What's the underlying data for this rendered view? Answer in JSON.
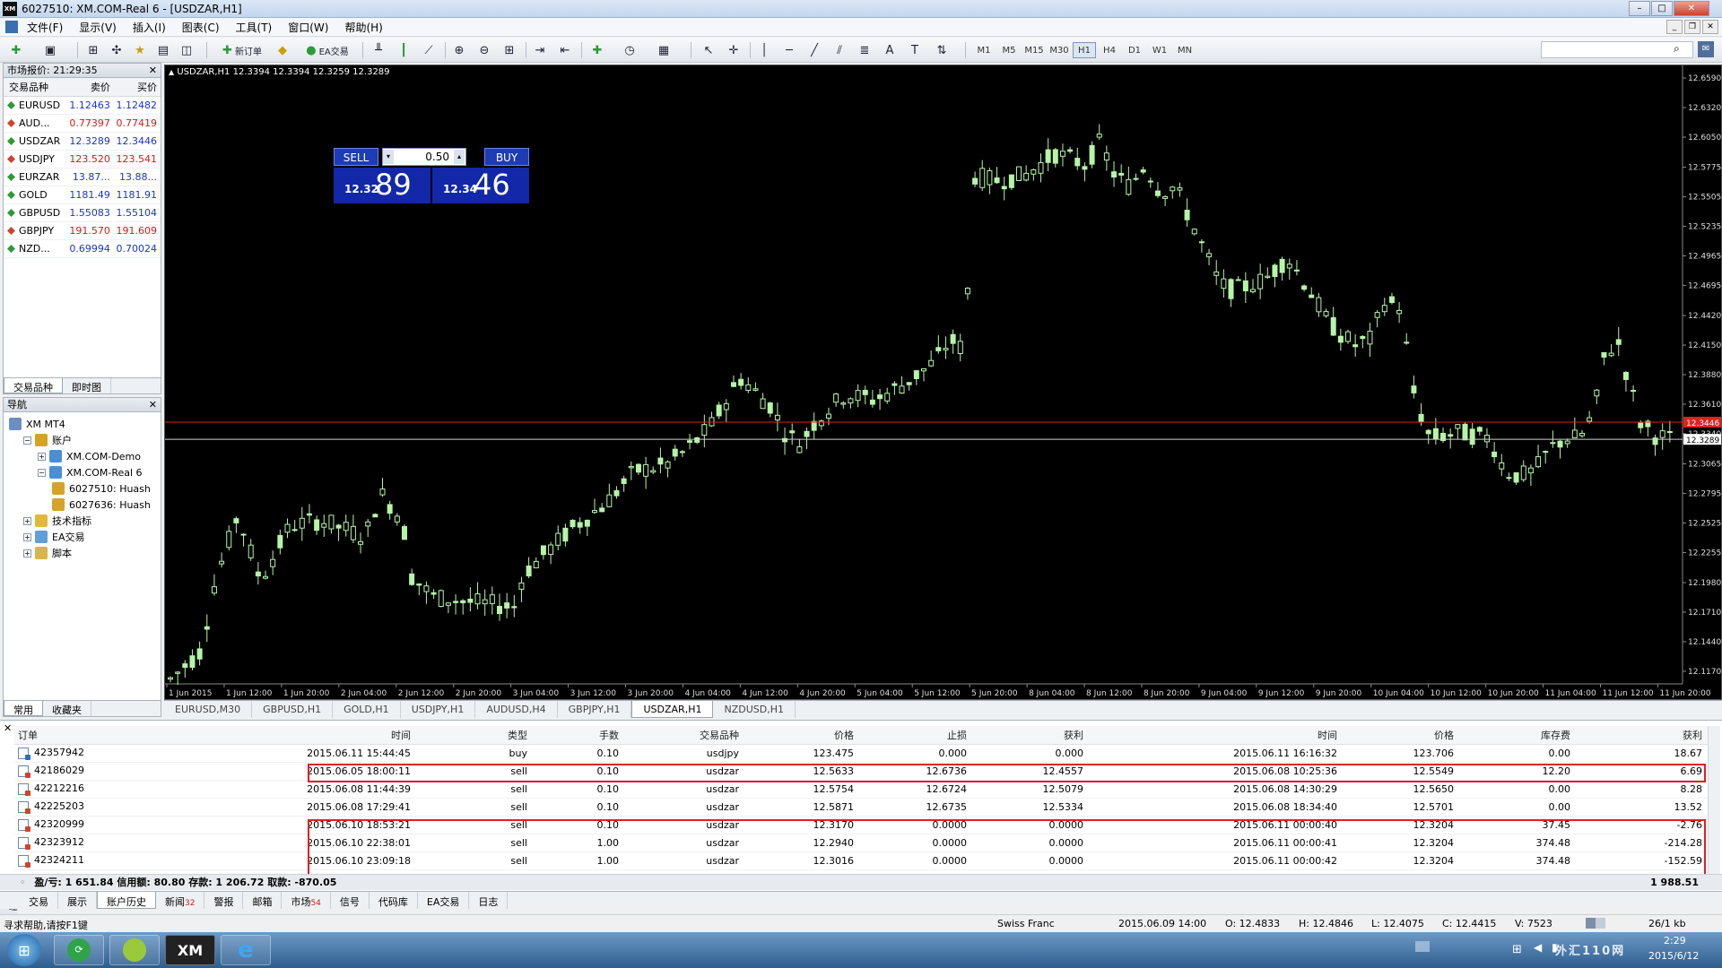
{
  "window": {
    "title": "6027510: XM.COM-Real 6 - [USDZAR,H1]",
    "app_icon": "XM"
  },
  "menu": [
    "文件(F)",
    "显示(V)",
    "插入(I)",
    "图表(C)",
    "工具(T)",
    "窗口(W)",
    "帮助(H)"
  ],
  "toolbar": {
    "new_order": "新订单",
    "ea_trading": "EA交易",
    "timeframes": [
      "M1",
      "M5",
      "M15",
      "M30",
      "H1",
      "H4",
      "D1",
      "W1",
      "MN"
    ],
    "active_timeframe": "H1"
  },
  "market_watch": {
    "title": "市场报价: 21:29:35",
    "headers": [
      "交易品种",
      "卖价",
      "买价"
    ],
    "rows": [
      {
        "symbol": "EURUSD",
        "bid": "1.12463",
        "ask": "1.12482",
        "dir": "up"
      },
      {
        "symbol": "AUD...",
        "bid": "0.77397",
        "ask": "0.77419",
        "dir": "down"
      },
      {
        "symbol": "USDZAR",
        "bid": "12.3289",
        "ask": "12.3446",
        "dir": "up"
      },
      {
        "symbol": "USDJPY",
        "bid": "123.520",
        "ask": "123.541",
        "dir": "down"
      },
      {
        "symbol": "EURZAR",
        "bid": "13.87...",
        "ask": "13.88...",
        "dir": "up"
      },
      {
        "symbol": "GOLD",
        "bid": "1181.49",
        "ask": "1181.91",
        "dir": "up"
      },
      {
        "symbol": "GBPUSD",
        "bid": "1.55083",
        "ask": "1.55104",
        "dir": "up"
      },
      {
        "symbol": "GBPJPY",
        "bid": "191.570",
        "ask": "191.609",
        "dir": "down"
      },
      {
        "symbol": "NZD...",
        "bid": "0.69994",
        "ask": "0.70024",
        "dir": "up"
      }
    ],
    "tabs": [
      "交易品种",
      "即时图"
    ]
  },
  "navigator": {
    "title": "导航",
    "items": [
      {
        "label": "XM MT4",
        "level": 0,
        "icon": "terminal-icon"
      },
      {
        "label": "账户",
        "level": 1,
        "icon": "accounts-icon"
      },
      {
        "label": "XM.COM-Demo",
        "level": 2,
        "icon": "server-icon"
      },
      {
        "label": "XM.COM-Real 6",
        "level": 2,
        "icon": "server-icon"
      },
      {
        "label": "6027510: Huash",
        "level": 3,
        "icon": "account-icon"
      },
      {
        "label": "6027636: Huash",
        "level": 3,
        "icon": "account-icon"
      },
      {
        "label": "技术指标",
        "level": 1,
        "icon": "indicators-icon"
      },
      {
        "label": "EA交易",
        "level": 1,
        "icon": "expert-icon"
      },
      {
        "label": "脚本",
        "level": 1,
        "icon": "scripts-icon"
      }
    ],
    "tabs": [
      "常用",
      "收藏夹"
    ]
  },
  "chart": {
    "header": "USDZAR,H1  12.3394 12.3394 12.3259 12.3289",
    "trade_panel": {
      "sell": "SELL",
      "buy": "BUY",
      "lot": "0.50",
      "sell_small": "12.32",
      "sell_big": "89",
      "buy_small": "12.34",
      "buy_big": "46"
    },
    "price_labels": [
      "12.6590",
      "12.6320",
      "12.6050",
      "12.5775",
      "12.5505",
      "12.5235",
      "12.4965",
      "12.4695",
      "12.4420",
      "12.4150",
      "12.3880",
      "12.3610",
      "12.3340",
      "12.3065",
      "12.2795",
      "12.2525",
      "12.2255",
      "12.1980",
      "12.1710",
      "12.1440",
      "12.1170"
    ],
    "current_bid_label": "12.3289",
    "ask_line_label": "12.3446",
    "time_labels": [
      "1 Jun 2015",
      "1 Jun 12:00",
      "1 Jun 20:00",
      "2 Jun 04:00",
      "2 Jun 12:00",
      "2 Jun 20:00",
      "3 Jun 04:00",
      "3 Jun 12:00",
      "3 Jun 20:00",
      "4 Jun 04:00",
      "4 Jun 12:00",
      "4 Jun 20:00",
      "5 Jun 04:00",
      "5 Jun 12:00",
      "5 Jun 20:00",
      "8 Jun 04:00",
      "8 Jun 12:00",
      "8 Jun 20:00",
      "9 Jun 04:00",
      "9 Jun 12:00",
      "9 Jun 20:00",
      "10 Jun 04:00",
      "10 Jun 12:00",
      "10 Jun 20:00",
      "11 Jun 04:00",
      "11 Jun 12:00",
      "11 Jun 20:00"
    ],
    "colors": {
      "background": "#000000",
      "candle": "#b6f5a8",
      "ask_line": "#e02020",
      "bid_line": "#cfcfcf"
    }
  },
  "chart_tabs": [
    "EURUSD,M30",
    "GBPUSD,H1",
    "GOLD,H1",
    "USDJPY,H1",
    "AUDUSD,H4",
    "GBPJPY,H1",
    "USDZAR,H1",
    "NZDUSD,H1"
  ],
  "active_chart_tab": "USDZAR,H1",
  "history": {
    "headers": [
      "订单",
      "时间",
      "类型",
      "手数",
      "交易品种",
      "价格",
      "止损",
      "获利",
      "时间",
      "价格",
      "库存费",
      "获利"
    ],
    "rows": [
      {
        "order": "42357942",
        "open_time": "2015.06.11 15:44:45",
        "type": "buy",
        "lots": "0.10",
        "symbol": "usdjpy",
        "price": "123.475",
        "sl": "0.000",
        "tp": "0.000",
        "close_time": "2015.06.11 16:16:32",
        "close_price": "123.706",
        "swap": "0.00",
        "profit": "18.67",
        "icon": "blue"
      },
      {
        "order": "42186029",
        "open_time": "2015.06.05 18:00:11",
        "type": "sell",
        "lots": "0.10",
        "symbol": "usdzar",
        "price": "12.5633",
        "sl": "12.6736",
        "tp": "12.4557",
        "close_time": "2015.06.08 10:25:36",
        "close_price": "12.5549",
        "swap": "12.20",
        "profit": "6.69",
        "icon": "red"
      },
      {
        "order": "42212216",
        "open_time": "2015.06.08 11:44:39",
        "type": "sell",
        "lots": "0.10",
        "symbol": "usdzar",
        "price": "12.5754",
        "sl": "12.6724",
        "tp": "12.5079",
        "close_time": "2015.06.08 14:30:29",
        "close_price": "12.5650",
        "swap": "0.00",
        "profit": "8.28",
        "icon": "red"
      },
      {
        "order": "42225203",
        "open_time": "2015.06.08 17:29:41",
        "type": "sell",
        "lots": "0.10",
        "symbol": "usdzar",
        "price": "12.5871",
        "sl": "12.6735",
        "tp": "12.5334",
        "close_time": "2015.06.08 18:34:40",
        "close_price": "12.5701",
        "swap": "0.00",
        "profit": "13.52",
        "icon": "red"
      },
      {
        "order": "42320999",
        "open_time": "2015.06.10 18:53:21",
        "type": "sell",
        "lots": "0.10",
        "symbol": "usdzar",
        "price": "12.3170",
        "sl": "0.0000",
        "tp": "0.0000",
        "close_time": "2015.06.11 00:00:40",
        "close_price": "12.3204",
        "swap": "37.45",
        "profit": "-2.76",
        "icon": "red"
      },
      {
        "order": "42323912",
        "open_time": "2015.06.10 22:38:01",
        "type": "sell",
        "lots": "1.00",
        "symbol": "usdzar",
        "price": "12.2940",
        "sl": "0.0000",
        "tp": "0.0000",
        "close_time": "2015.06.11 00:00:41",
        "close_price": "12.3204",
        "swap": "374.48",
        "profit": "-214.28",
        "icon": "red"
      },
      {
        "order": "42324211",
        "open_time": "2015.06.10 23:09:18",
        "type": "sell",
        "lots": "1.00",
        "symbol": "usdzar",
        "price": "12.3016",
        "sl": "0.0000",
        "tp": "0.0000",
        "close_time": "2015.06.11 00:00:42",
        "close_price": "12.3204",
        "swap": "374.48",
        "profit": "-152.59",
        "icon": "red"
      }
    ],
    "summary_left": "盈/亏: 1 651.84  信用额: 80.80  存款: 1 206.72  取款: -870.05",
    "summary_right": "1 988.51"
  },
  "terminal_tabs": [
    {
      "label": "交易",
      "badge": ""
    },
    {
      "label": "展示",
      "badge": ""
    },
    {
      "label": "账户历史",
      "badge": ""
    },
    {
      "label": "新闻",
      "badge": "32"
    },
    {
      "label": "警报",
      "badge": ""
    },
    {
      "label": "邮箱",
      "badge": ""
    },
    {
      "label": "市场",
      "badge": "54"
    },
    {
      "label": "信号",
      "badge": ""
    },
    {
      "label": "代码库",
      "badge": ""
    },
    {
      "label": "EA交易",
      "badge": ""
    },
    {
      "label": "日志",
      "badge": ""
    }
  ],
  "active_terminal_tab": "账户历史",
  "terminal_side_label": "终端",
  "status": {
    "help": "寻求帮助,请按F1键",
    "profile": "Swiss Franc",
    "datetime": "2015.06.09 14:00",
    "open": "O: 12.4833",
    "high": "H: 12.4846",
    "low": "L: 12.4075",
    "close": "C: 12.4415",
    "volume": "V: 7523",
    "traffic": "26/1 kb"
  },
  "taskbar": {
    "clock_time": "2:29",
    "clock_date": "2015/6/12",
    "watermark": "外汇110网"
  }
}
